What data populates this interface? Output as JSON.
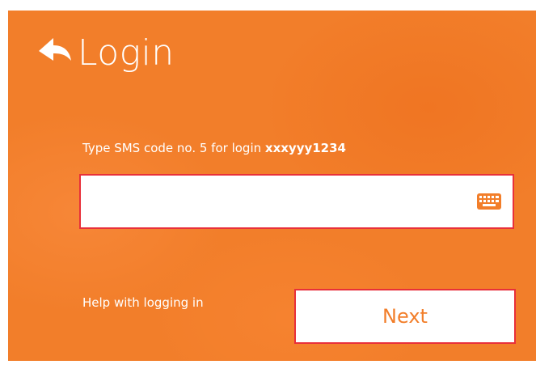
{
  "header": {
    "title": "Login",
    "back_icon": "back-arrow-icon"
  },
  "prompt": {
    "prefix": "Type SMS code no. 5 for login ",
    "login_id": "xxxyyy1234"
  },
  "code_input": {
    "value": "",
    "placeholder": "",
    "keyboard_icon": "keyboard-icon"
  },
  "footer": {
    "help_link": "Help with logging in",
    "next_button": "Next"
  },
  "colors": {
    "background": "#f27e2a",
    "border_accent": "#e8303a",
    "button_text": "#f27e2a",
    "text": "#ffffff"
  }
}
